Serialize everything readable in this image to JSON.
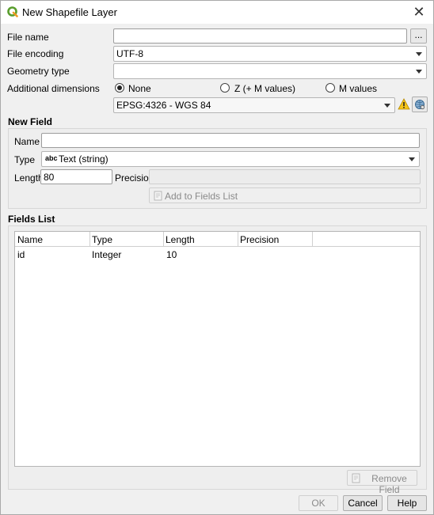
{
  "window": {
    "title": "New Shapefile Layer",
    "close": "✕"
  },
  "form": {
    "file_name_label": "File name",
    "file_name_value": "",
    "browse_label": "...",
    "file_encoding_label": "File encoding",
    "file_encoding_value": "UTF-8",
    "geometry_type_label": "Geometry type",
    "geometry_type_value": "",
    "additional_dimensions_label": "Additional dimensions",
    "dimensions": [
      {
        "label": "None",
        "checked": true
      },
      {
        "label": "Z (+ M values)",
        "checked": false
      },
      {
        "label": "M values",
        "checked": false
      }
    ],
    "crs_value": "EPSG:4326 - WGS 84"
  },
  "new_field": {
    "title": "New Field",
    "name_label": "Name",
    "name_value": "",
    "type_label": "Type",
    "type_icon": "abc",
    "type_value": "Text (string)",
    "length_label": "Length",
    "length_value": "80",
    "precision_label": "Precision",
    "precision_value": "",
    "add_button": "Add to Fields List"
  },
  "fields_list": {
    "title": "Fields List",
    "columns": [
      "Name",
      "Type",
      "Length",
      "Precision"
    ],
    "rows": [
      {
        "name": "id",
        "type": "Integer",
        "length": "10",
        "precision": ""
      }
    ],
    "remove_button": "Remove Field"
  },
  "buttons": {
    "ok": "OK",
    "cancel": "Cancel",
    "help": "Help"
  }
}
